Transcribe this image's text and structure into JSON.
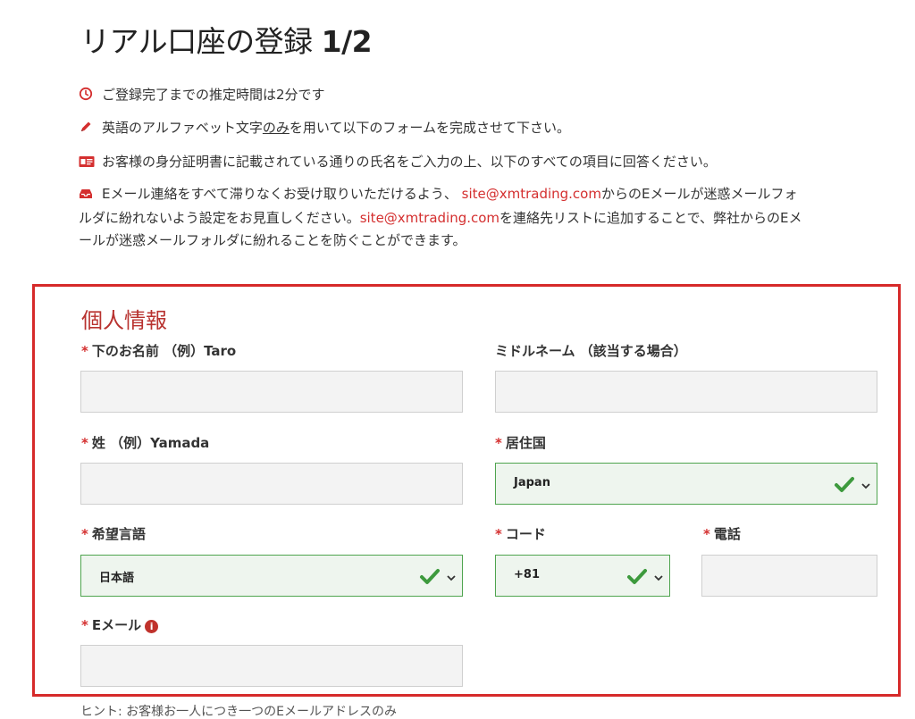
{
  "header": {
    "title": "リアル口座の登録",
    "step": "1/2"
  },
  "notices": {
    "time_text": "ご登録完了までの推定時間は2分です",
    "alphabet_before": "英語のアルファベット文字",
    "alphabet_underlined": "のみ",
    "alphabet_after": "を用いて以下のフォームを完成させて下さい。",
    "id_text": "お客様の身分証明書に記載されている通りの氏名をご入力の上、以下のすべての項目に回答ください。",
    "email_line1_before": "Eメール連絡をすべて滞りなくお受け取りいただけるよう、",
    "email_address": "site@xmtrading.com",
    "email_line1_after": "からのEメールが迷惑メールフォ",
    "email_line2_before": "ルダに紛れないよう設定をお見直しください。",
    "email_line2_after": "を連絡先リストに追加することで、弊社からのEメ",
    "email_line3": "ールが迷惑メールフォルダに紛れることを防ぐことができます。"
  },
  "form": {
    "section_title": "個人情報",
    "required_mark": "*",
    "first_name_label": "下のお名前 （例）Taro",
    "middle_name_label": "ミドルネーム （該当する場合）",
    "last_name_label": "姓 （例）Yamada",
    "country_label": "居住国",
    "country_value": "Japan",
    "language_label": "希望言語",
    "language_value": "日本語",
    "code_label": "コード",
    "code_value": "+81",
    "phone_label": "電話",
    "email_label": "Eメール",
    "email_info": "i"
  },
  "hint": "ヒント: お客様お一人につき一つのEメールアドレスのみ",
  "icons": [
    "clock-icon",
    "pencil-icon",
    "id-card-icon",
    "inbox-icon",
    "checkmark-icon",
    "chevron-down-icon",
    "info-icon"
  ],
  "colors": {
    "accent_red": "#d62a2a",
    "valid_green": "#3d9a3d"
  }
}
